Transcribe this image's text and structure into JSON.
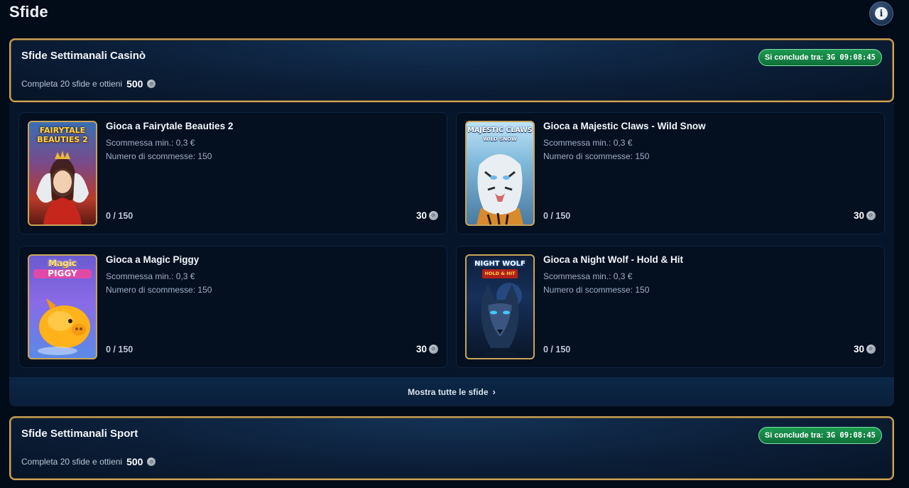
{
  "page": {
    "title": "Sfide"
  },
  "casino": {
    "title": "Sfide Settimanali Casinò",
    "subtitle": "Completa 20 sfide e ottieni",
    "reward": "500",
    "timer_label": "Si conclude tra:",
    "timer_value": "3G 09:08:45"
  },
  "cards": [
    {
      "thumb_text_1": "FAIRYTALE",
      "thumb_text_2": "BEAUTIES 2",
      "title": "Gioca a Fairytale Beauties 2",
      "min_bet": "Scommessa min.: 0,3 €",
      "bets": "Numero di scommesse: 150",
      "progress": "0 / 150",
      "points": "30"
    },
    {
      "thumb_text_1": "MAJESTIC CLAWS",
      "thumb_text_2": "WILD SNOW",
      "title": "Gioca a Majestic Claws - Wild Snow",
      "min_bet": "Scommessa min.: 0,3 €",
      "bets": "Numero di scommesse: 150",
      "progress": "0 / 150",
      "points": "30"
    },
    {
      "thumb_text_1": "Magic",
      "thumb_text_2": "PIGGY",
      "title": "Gioca a Magic Piggy",
      "min_bet": "Scommessa min.: 0,3 €",
      "bets": "Numero di scommesse: 150",
      "progress": "0 / 150",
      "points": "30"
    },
    {
      "thumb_text_1": "NIGHT WOLF",
      "thumb_text_2": "HOLD & HIT",
      "title": "Gioca a Night Wolf - Hold & Hit",
      "min_bet": "Scommessa min.: 0,3 €",
      "bets": "Numero di scommesse: 150",
      "progress": "0 / 150",
      "points": "30"
    }
  ],
  "show_all": {
    "label": "Mostra tutte le sfide",
    "icon": "chevron-right-icon"
  },
  "sport": {
    "title": "Sfide Settimanali Sport",
    "subtitle": "Completa 20 sfide e ottieni",
    "reward": "500",
    "timer_label": "Si conclude tra:",
    "timer_value": "3G 09:08:45"
  },
  "colors": {
    "background": "#020b18",
    "gold_border": "#c9a45a",
    "timer_green": "#1c9a52"
  }
}
